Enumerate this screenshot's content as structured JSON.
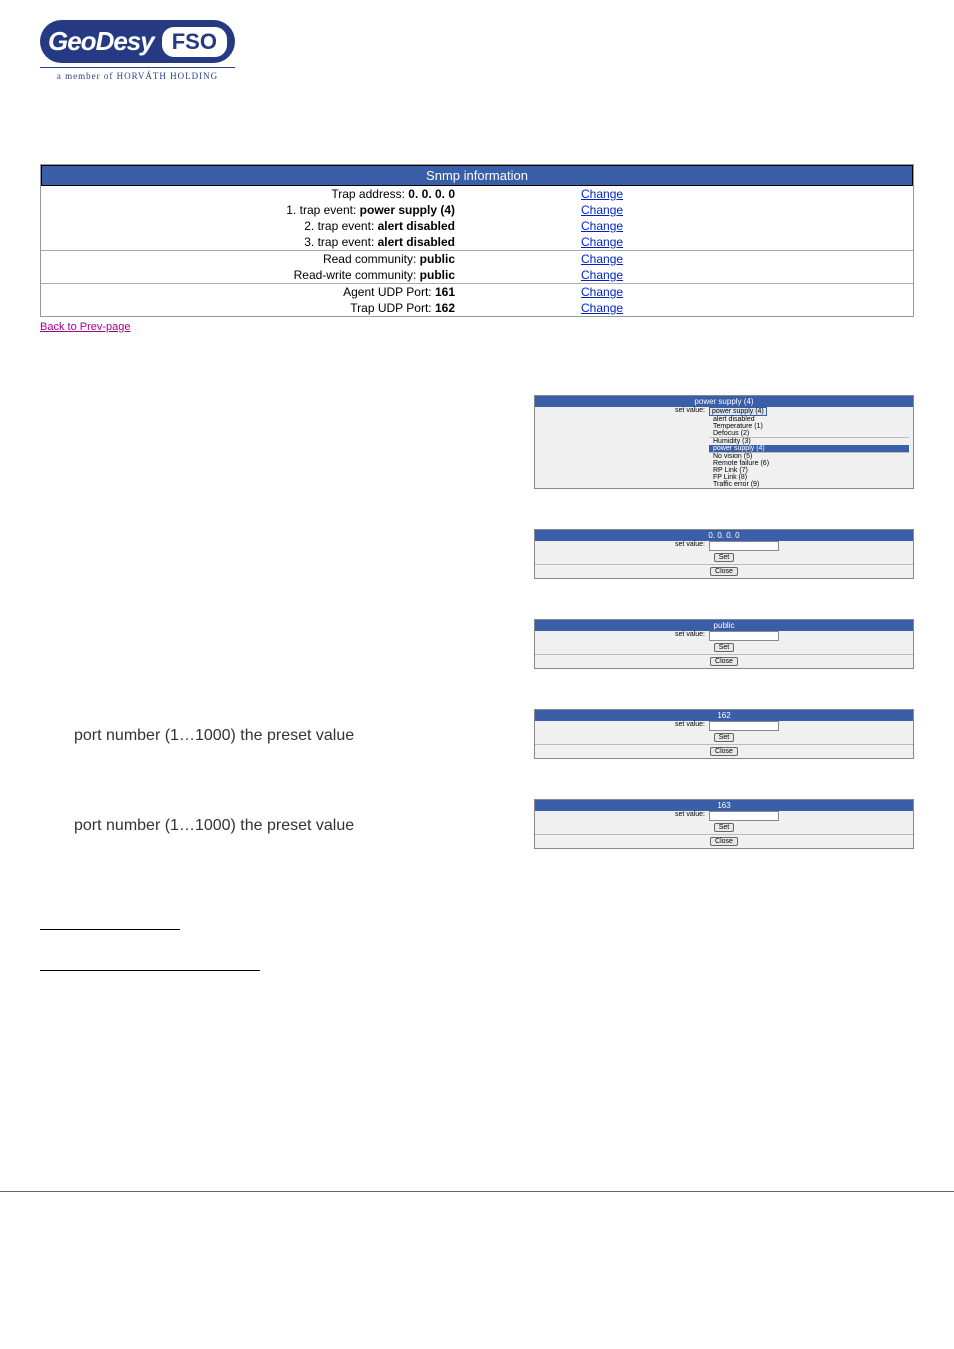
{
  "logo": {
    "main": "GeoDesy",
    "badge": "FSO",
    "subtitle": "a member of HORVÁTH HOLDING"
  },
  "snmp": {
    "title": "Snmp information",
    "group1": [
      {
        "label": "Trap address:",
        "value": "0. 0. 0. 0",
        "action": "Change"
      },
      {
        "label": "1. trap event:",
        "value": "power supply (4)",
        "action": "Change"
      },
      {
        "label": "2. trap event:",
        "value": "alert disabled",
        "action": "Change"
      },
      {
        "label": "3. trap event:",
        "value": "alert disabled",
        "action": "Change"
      }
    ],
    "group2": [
      {
        "label": "Read community:",
        "value": "public",
        "action": "Change"
      },
      {
        "label": "Read-write community:",
        "value": "public",
        "action": "Change"
      }
    ],
    "group3": [
      {
        "label": "Agent UDP Port:",
        "value": "161",
        "action": "Change"
      },
      {
        "label": "Trap UDP Port:",
        "value": "162",
        "action": "Change"
      }
    ],
    "back": "Back to Prev-page"
  },
  "dropdown_panel": {
    "title": "power supply (4)",
    "set_label": "set value:",
    "selected": "power supply (4)",
    "options": [
      "alert disabled",
      "Temperature (1)",
      "Defocus (2)",
      "Humidity (3)",
      "power supply (4)",
      "No vision (5)",
      "Remote failure (6)",
      "RP Link (7)",
      "FP Link (8)",
      "Traffic error (9)"
    ]
  },
  "panels": {
    "ip": {
      "title": "0. 0. 0. 0",
      "set_label": "set value:",
      "btn_set": "Set",
      "btn_close": "Close"
    },
    "public": {
      "title": "public",
      "set_label": "set value:",
      "btn_set": "Set",
      "btn_close": "Close"
    },
    "p161": {
      "title": "162",
      "set_label": "set value:",
      "btn_set": "Set",
      "btn_close": "Close"
    },
    "p162": {
      "title": "163",
      "set_label": "set value:",
      "btn_set": "Set",
      "btn_close": "Close"
    }
  },
  "captions": {
    "port1": "port number (1…1000) the preset value",
    "port2": "port number (1…1000) the preset value"
  }
}
